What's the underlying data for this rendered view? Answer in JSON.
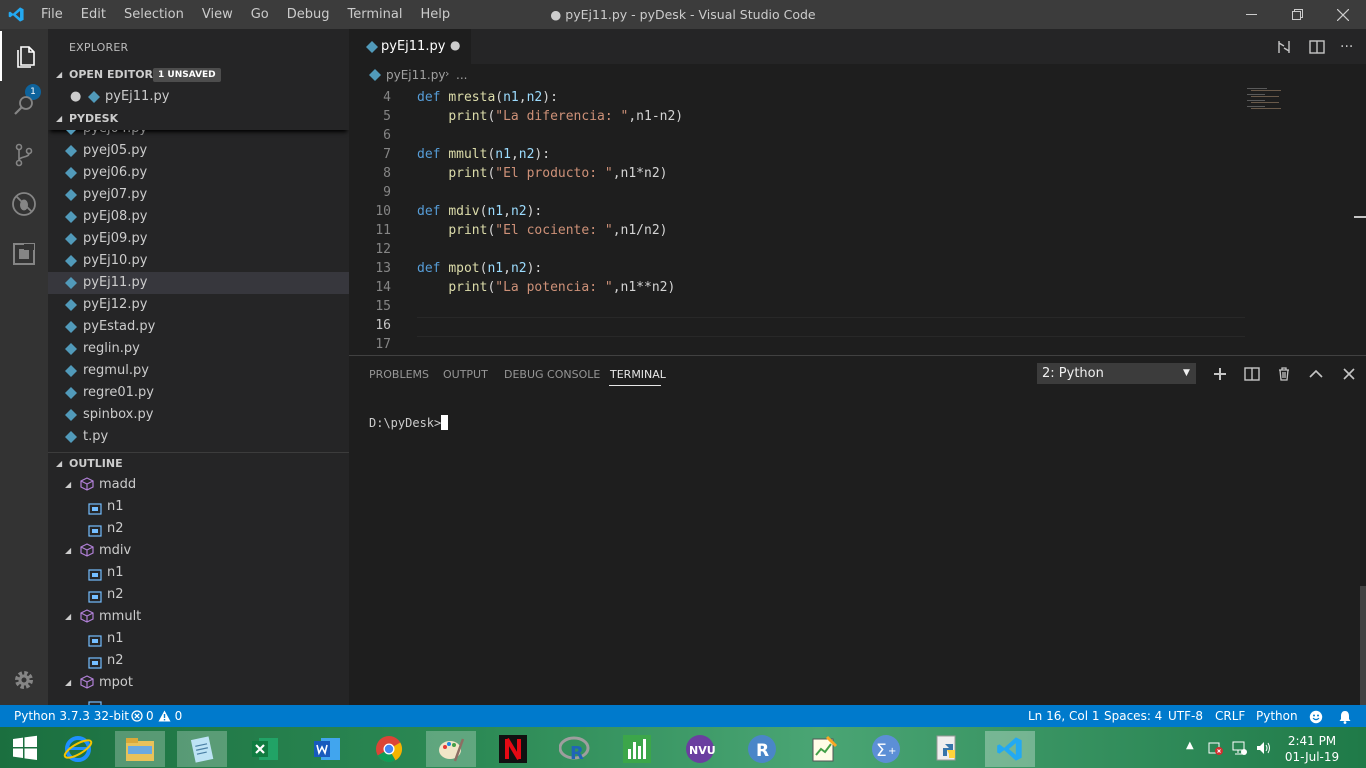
{
  "window": {
    "title": "● pyEj11.py - pyDesk - Visual Studio Code",
    "menu": [
      "File",
      "Edit",
      "Selection",
      "View",
      "Go",
      "Debug",
      "Terminal",
      "Help"
    ]
  },
  "activity_bar": {
    "explorer_badge": "1"
  },
  "sidebar": {
    "header": "EXPLORER",
    "open_editors": {
      "label": "OPEN EDITORS",
      "badge": "1 UNSAVED",
      "files": [
        "pyEj11.py"
      ]
    },
    "folder": {
      "label": "PYDESK",
      "files": [
        "pyej05.py",
        "pyej06.py",
        "pyej07.py",
        "pyEj08.py",
        "pyEj09.py",
        "pyEj10.py",
        "pyEj11.py",
        "pyEj12.py",
        "pyEstad.py",
        "reglin.py",
        "regmul.py",
        "regre01.py",
        "spinbox.py",
        "t.py"
      ],
      "selected": "pyEj11.py"
    },
    "outline": {
      "label": "OUTLINE",
      "items": [
        {
          "name": "madd",
          "children": [
            "n1",
            "n2"
          ]
        },
        {
          "name": "mdiv",
          "children": [
            "n1",
            "n2"
          ]
        },
        {
          "name": "mmult",
          "children": [
            "n1",
            "n2"
          ]
        },
        {
          "name": "mpot",
          "children": []
        }
      ]
    }
  },
  "editor": {
    "tab_label": "pyEj11.py",
    "breadcrumb": [
      "pyEj11.py",
      "..."
    ],
    "lines": [
      {
        "num": "4",
        "text": "def mresta(n1,n2):"
      },
      {
        "num": "5",
        "text": "    print(\"La diferencia: \",n1-n2)"
      },
      {
        "num": "6",
        "text": ""
      },
      {
        "num": "7",
        "text": "def mmult(n1,n2):"
      },
      {
        "num": "8",
        "text": "    print(\"El producto: \",n1*n2)"
      },
      {
        "num": "9",
        "text": ""
      },
      {
        "num": "10",
        "text": "def mdiv(n1,n2):"
      },
      {
        "num": "11",
        "text": "    print(\"El cociente: \",n1/n2)"
      },
      {
        "num": "12",
        "text": ""
      },
      {
        "num": "13",
        "text": "def mpot(n1,n2):"
      },
      {
        "num": "14",
        "text": "    print(\"La potencia: \",n1**n2)"
      },
      {
        "num": "15",
        "text": ""
      },
      {
        "num": "16",
        "text": ""
      },
      {
        "num": "17",
        "text": ""
      }
    ]
  },
  "panel": {
    "tabs": [
      "PROBLEMS",
      "OUTPUT",
      "DEBUG CONSOLE",
      "TERMINAL"
    ],
    "active_tab": "TERMINAL",
    "terminal_select": "2: Python",
    "prompt": "D:\\pyDesk>"
  },
  "status_bar": {
    "interpreter": "Python 3.7.3 32-bit",
    "errors": "0",
    "warnings": "0",
    "position": "Ln 16, Col 1",
    "spaces": "Spaces: 4",
    "encoding": "UTF-8",
    "eol": "CRLF",
    "language": "Python"
  },
  "taskbar": {
    "time": "2:41 PM",
    "date": "01-Jul-19"
  },
  "colors": {
    "accent": "#007acc",
    "keyword": "#569cd6",
    "function": "#dcdcaa",
    "param": "#9cdcfe",
    "string": "#ce9178"
  }
}
